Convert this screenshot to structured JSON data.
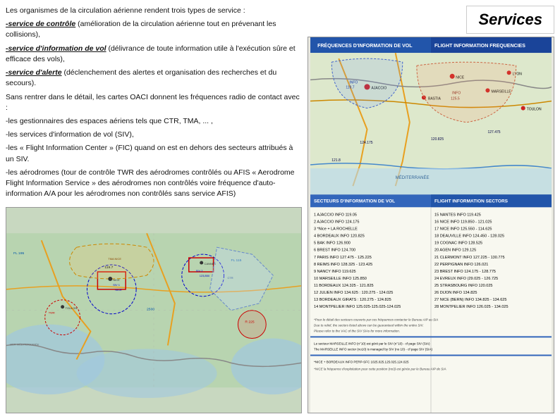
{
  "title": "Services",
  "text": {
    "intro": "Les organismes de la circulation aérienne rendent trois types de service :",
    "service1_label": "-service de contrôle",
    "service1_text": " (amélioration de la circulation aérienne tout en prévenant les collisions),",
    "service2_label": "-service d'information de vol",
    "service2_text": " (délivrance de toute information utile à l'exécution sûre et efficace des vols),",
    "service3_label": "-service d'alerte",
    "service3_text": " (déclenchement des alertes et organisation des recherches et du secours).",
    "para2": "Sans rentrer dans le détail, les cartes OACI donnent les fréquences radio de contact avec :",
    "bullet1": "-les gestionnaires des espaces aériens tels que CTR, TMA, ... ,",
    "bullet2": "-les services d'information de vol (SIV),",
    "bullet3": "-les « Flight Information Center » (FIC) quand on est en dehors des secteurs attribués à un SIV.",
    "bullet4": "-les aérodromes (tour de contrôle TWR des aérodromes contrôlés ou AFIS « Aerodrome Flight Information Service » des aérodromes non contrôlés voire fréquence d'auto-information A/A pour les aérodromes non contrôlés sans service AFIS)"
  }
}
